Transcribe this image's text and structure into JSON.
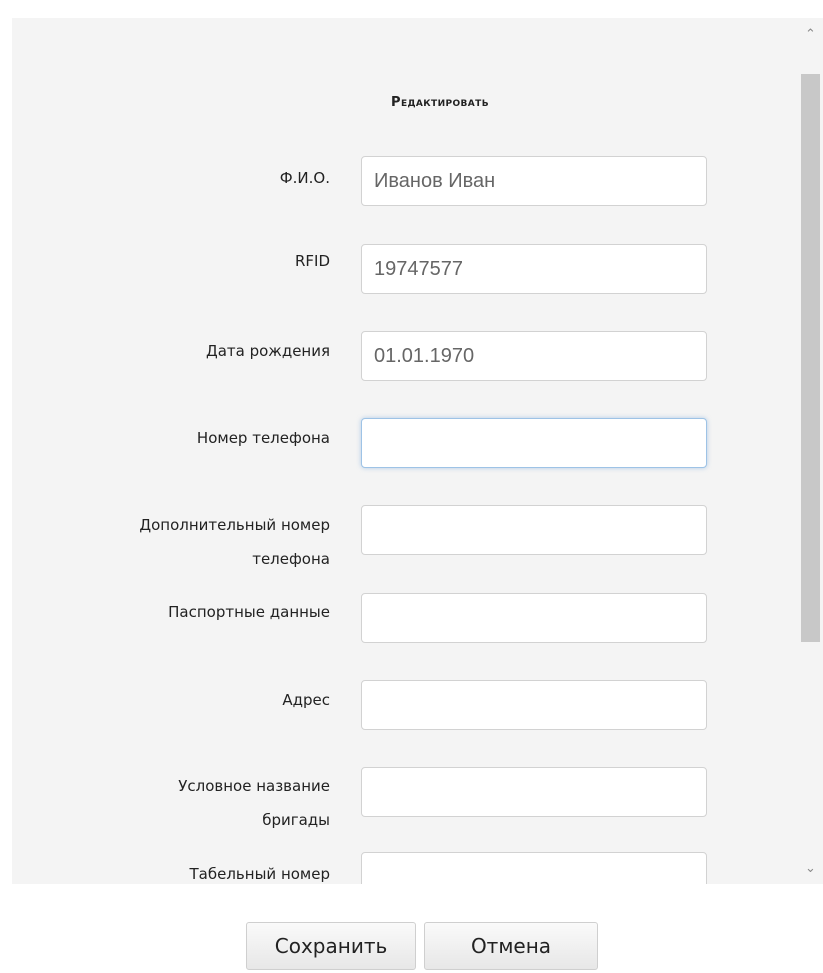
{
  "form": {
    "title": "Редактировать",
    "fields": [
      {
        "label": "Ф.И.О.",
        "value": "Иванов Иван"
      },
      {
        "label": "RFID",
        "value": "19747577"
      },
      {
        "label": "Дата рождения",
        "value": "01.01.1970"
      },
      {
        "label": "Номер телефона",
        "value": ""
      },
      {
        "label_line1": "Дополнительный номер",
        "label_line2": "телефона",
        "value": ""
      },
      {
        "label": "Паспортные данные",
        "value": ""
      },
      {
        "label": "Адрес",
        "value": ""
      },
      {
        "label_line1": "Условное название",
        "label_line2": "бригады",
        "value": ""
      },
      {
        "label": "Табельный номер",
        "value": ""
      }
    ]
  },
  "buttons": {
    "save": "Сохранить",
    "cancel": "Отмена"
  },
  "scrollbar": {
    "up_icon": "chevron-up-icon",
    "down_icon": "chevron-down-icon"
  }
}
